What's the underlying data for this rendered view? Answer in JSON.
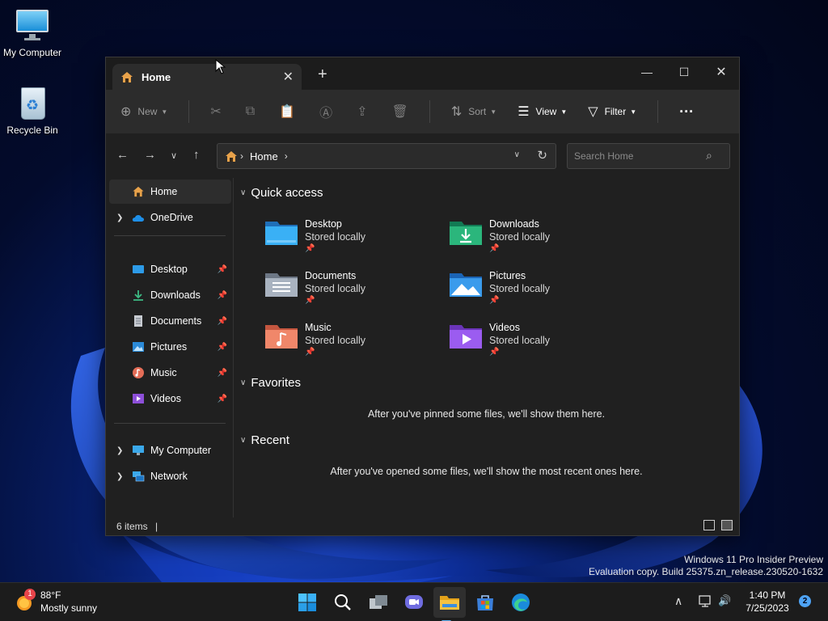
{
  "colors": {
    "accent": "#4ea3f5",
    "window_bg": "#202020",
    "toolbar_bg": "#2c2c2c",
    "folder_yellow": "#f5c242"
  },
  "desktop": {
    "icons": [
      {
        "label": "My Computer",
        "icon": "monitor-icon"
      },
      {
        "label": "Recycle Bin",
        "icon": "recycle-bin-icon"
      }
    ],
    "watermark": {
      "line1": "Windows 11 Pro Insider Preview",
      "line2": "Evaluation copy. Build 25375.zn_release.230520-1632"
    }
  },
  "explorer": {
    "tab": {
      "label": "Home",
      "close": "✕",
      "new_tab": "+"
    },
    "window_controls": {
      "minimize": "—",
      "maximize": "☐",
      "close": "✕"
    },
    "toolbar": {
      "new": "New",
      "sort": "Sort",
      "view": "View",
      "filter": "Filter",
      "more": "···"
    },
    "address": {
      "crumb": "Home",
      "separator": "›"
    },
    "search": {
      "placeholder": "Search Home"
    },
    "sidebar": {
      "top": [
        {
          "label": "Home"
        },
        {
          "label": "OneDrive"
        }
      ],
      "pinned": [
        {
          "label": "Desktop"
        },
        {
          "label": "Downloads"
        },
        {
          "label": "Documents"
        },
        {
          "label": "Pictures"
        },
        {
          "label": "Music"
        },
        {
          "label": "Videos"
        }
      ],
      "bottom": [
        {
          "label": "My Computer"
        },
        {
          "label": "Network"
        }
      ]
    },
    "quick_access": {
      "title": "Quick access",
      "items": [
        {
          "name": "Desktop",
          "sub": "Stored locally"
        },
        {
          "name": "Downloads",
          "sub": "Stored locally"
        },
        {
          "name": "Documents",
          "sub": "Stored locally"
        },
        {
          "name": "Pictures",
          "sub": "Stored locally"
        },
        {
          "name": "Music",
          "sub": "Stored locally"
        },
        {
          "name": "Videos",
          "sub": "Stored locally"
        }
      ]
    },
    "favorites": {
      "title": "Favorites",
      "empty": "After you've pinned some files, we'll show them here."
    },
    "recent": {
      "title": "Recent",
      "empty": "After you've opened some files, we'll show the most recent ones here."
    },
    "status": {
      "count": "6 items",
      "caret": "|"
    }
  },
  "taskbar": {
    "weather": {
      "badge": "1",
      "temp": "88°F",
      "condition": "Mostly sunny"
    },
    "clock": {
      "time": "1:40 PM",
      "date": "7/25/2023"
    },
    "notifications": "2"
  }
}
